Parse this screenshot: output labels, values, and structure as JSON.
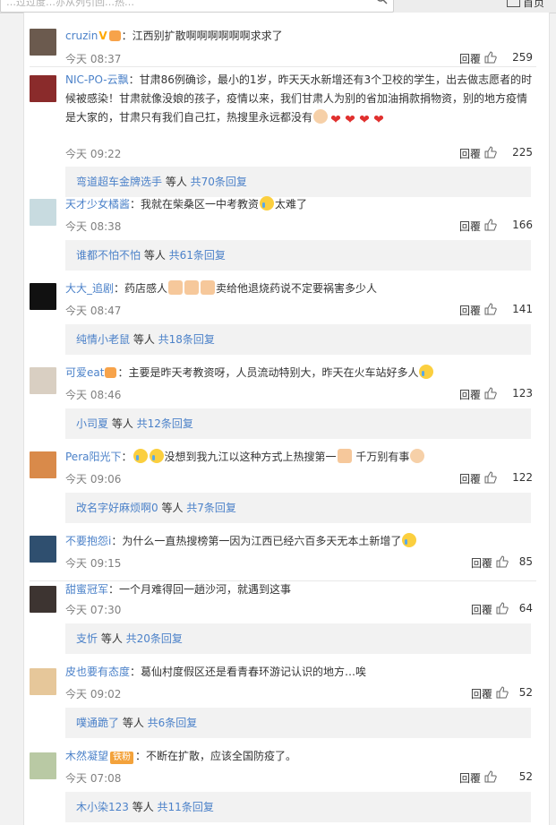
{
  "topbar": {
    "search_placeholder": "…过过度…亦从列引回…热…",
    "home_label": "首页"
  },
  "comments": [
    {
      "user": "cruzin",
      "badges": [
        "v",
        "crown"
      ],
      "text": "：江西别扩散啊啊啊啊啊啊求求了",
      "time": "今天 08:37",
      "reply": "回覆",
      "likes": "259",
      "sub": null
    },
    {
      "user": "NIC-PO-云飘",
      "badges": [],
      "text": "：甘肃86例确诊，最小的1岁，昨天天水新增还有3个卫校的学生，出去做志愿者的时候被感染！甘肃就像没娘的孩子，疫情以来，我们甘肃人为别的省加油捐款捐物资，别的地方疫情是大家的，甘肃只有我们自己扛，热搜里永远都没有",
      "emojis": [
        "girl",
        "heart",
        "heart",
        "heart",
        "heart"
      ],
      "time": "今天 09:22",
      "reply": "回覆",
      "likes": "225",
      "sub": {
        "who": "弯道超车金牌选手",
        "mid": " 等人 ",
        "count": "共70条回复"
      }
    },
    {
      "user": "天才少女橘酱",
      "badges": [],
      "text": "：我就在柴桑区一中考教资",
      "emojis": [
        "cry"
      ],
      "tail": "太难了",
      "time": "今天 08:38",
      "reply": "回覆",
      "likes": "166",
      "sub": {
        "who": "谁都不怕不怕",
        "mid": " 等人 ",
        "count": "共61条回复"
      }
    },
    {
      "user": "大大_追剧",
      "badges": [],
      "text": "：药店感人",
      "emojis": [
        "thumb",
        "thumb",
        "thumb"
      ],
      "tail": "卖给他退烧药说不定要祸害多少人",
      "time": "今天 08:47",
      "reply": "回覆",
      "likes": "141",
      "sub": {
        "who": "纯情小老鼠",
        "mid": " 等人 ",
        "count": "共18条回复"
      }
    },
    {
      "user": "可爱eat",
      "badges": [
        "crown"
      ],
      "text": "：主要是昨天考教资呀，人员流动特别大，昨天在火车站好多人",
      "emojis": [
        "cry"
      ],
      "time": "今天 08:46",
      "reply": "回覆",
      "likes": "123",
      "sub": {
        "who": "小司夏",
        "mid": " 等人 ",
        "count": "共12条回复"
      }
    },
    {
      "user": "Pera阳光下",
      "badges": [],
      "text": "：",
      "emojis": [
        "cry",
        "cry"
      ],
      "tail": "没想到我九江以这种方式上热搜第一",
      "tail2": " 千万别有事",
      "time": "今天 09:06",
      "reply": "回覆",
      "likes": "122",
      "sub": {
        "who": "改名字好麻烦啊0",
        "mid": " 等人 ",
        "count": "共7条回复"
      }
    },
    {
      "user": "不要抱怨i",
      "badges": [],
      "text": "：为什么一直热搜榜第一因为江西已经六百多天无本土新增了",
      "emojis": [
        "cry"
      ],
      "time": "今天 09:15",
      "reply": "回覆",
      "likes": "85",
      "sub": null
    },
    {
      "user": "甜蜜冠军",
      "badges": [],
      "text": "：一个月难得回一趟沙河，就遇到这事",
      "time": "今天 07:30",
      "reply": "回覆",
      "likes": "64",
      "sub": {
        "who": "支忻",
        "mid": " 等人 ",
        "count": "共20条回复"
      }
    },
    {
      "user": "皮也要有态度",
      "badges": [],
      "text": "：葛仙村度假区还是看青春环游记认识的地方…唉",
      "time": "今天 09:02",
      "reply": "回覆",
      "likes": "52",
      "sub": {
        "who": "噗通跪了",
        "mid": " 等人 ",
        "count": "共6条回复"
      }
    },
    {
      "user": "木然凝望",
      "badges": [
        "fan"
      ],
      "fan_label": "铁粉",
      "text": "：不断在扩散，应该全国防疫了。",
      "time": "今天 07:08",
      "reply": "回覆",
      "likes": "52",
      "sub": {
        "who": "木小染123",
        "mid": " 等人 ",
        "count": "共11条回复"
      }
    }
  ],
  "colors": {
    "username": "#eb7350",
    "link": "#4c82c9",
    "meta": "#808080",
    "sub_bg": "#f2f2f2"
  }
}
